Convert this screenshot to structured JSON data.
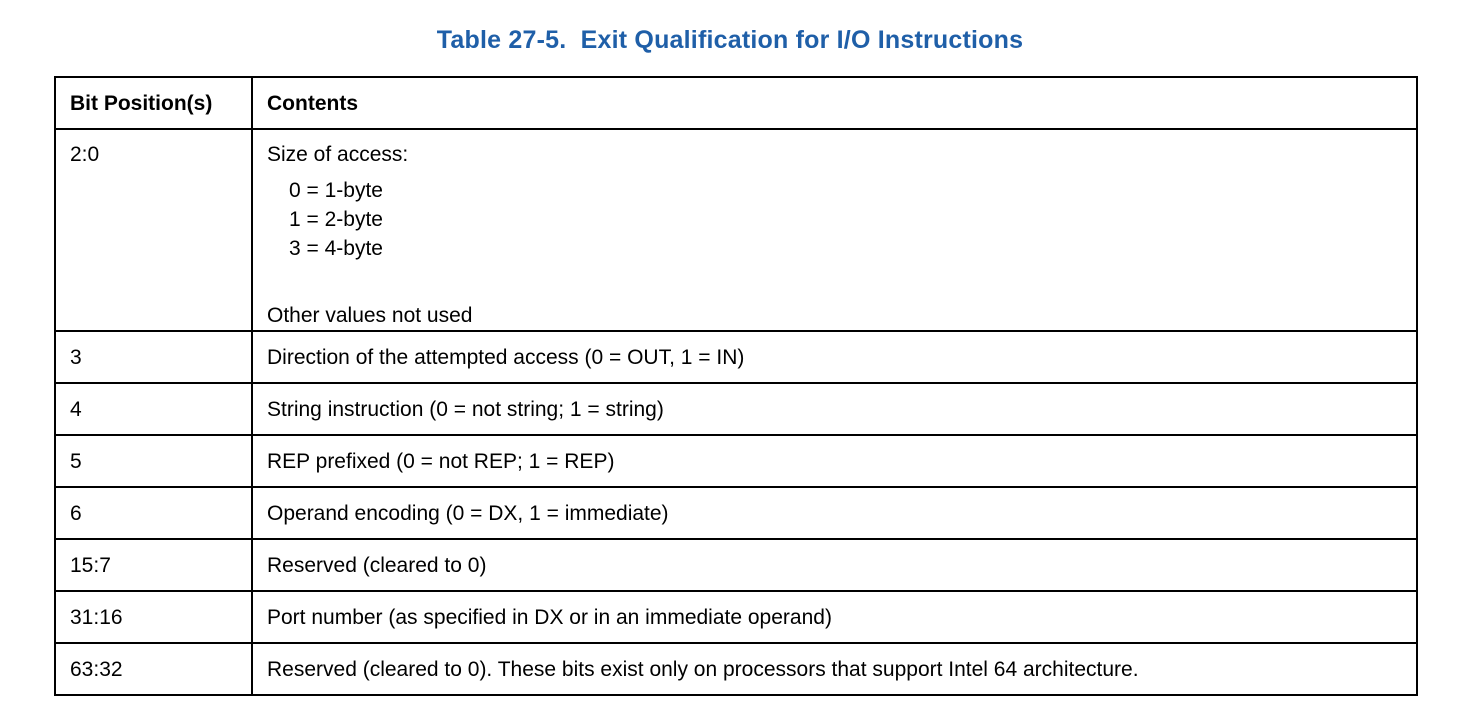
{
  "caption": "Table 27-5.  Exit Qualification for I/O Instructions",
  "headers": {
    "bit_position": "Bit Position(s)",
    "contents": "Contents"
  },
  "row0": {
    "bits": "2:0",
    "intro": "Size of access:",
    "values": [
      "0 = 1-byte",
      "1 = 2-byte",
      "3 = 4-byte"
    ],
    "footer": "Other values not used"
  },
  "rows": [
    {
      "bits": "3",
      "contents": "Direction of the attempted access (0 = OUT, 1 = IN)"
    },
    {
      "bits": "4",
      "contents": "String instruction (0 = not string; 1 = string)"
    },
    {
      "bits": "5",
      "contents": "REP prefixed (0 = not REP; 1 = REP)"
    },
    {
      "bits": "6",
      "contents": "Operand encoding (0 = DX, 1 = immediate)"
    },
    {
      "bits": "15:7",
      "contents": "Reserved (cleared to 0)"
    },
    {
      "bits": "31:16",
      "contents": "Port number (as specified in DX or in an immediate operand)"
    },
    {
      "bits": "63:32",
      "contents": "Reserved (cleared to 0). These bits exist only on processors that support Intel 64 architecture."
    }
  ],
  "colors": {
    "caption": "#1f5fa8",
    "border": "#000000"
  }
}
